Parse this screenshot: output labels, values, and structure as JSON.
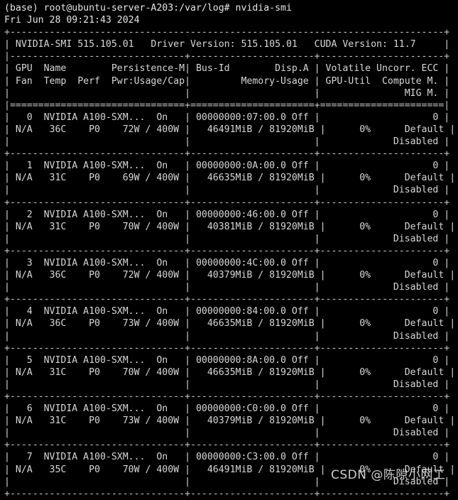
{
  "terminal": {
    "prompt": "(base) root@ubuntu-server-A203:/var/log# nvidia-smi",
    "timestamp": "Fri Jun 28 09:21:43 2024",
    "background_color": "#000000",
    "text_color": "#d8d8d8"
  },
  "smi_header": {
    "smi_label": "NVIDIA-SMI",
    "smi_version": "515.105.01",
    "driver_label": "Driver Version:",
    "driver_version": "515.105.01",
    "cuda_label": "CUDA Version:",
    "cuda_version": "11.7",
    "header_line": "| NVIDIA-SMI 515.105.01   Driver Version: 515.105.01   CUDA Version: 11.7     |"
  },
  "columns": {
    "row1": [
      "GPU",
      "Name",
      "Persistence-M",
      "Bus-Id",
      "Disp.A",
      "Volatile Uncorr. ECC"
    ],
    "row2": [
      "Fan",
      "Temp",
      "Perf",
      "Pwr:Usage/Cap",
      "Memory-Usage",
      "GPU-Util",
      "Compute M."
    ],
    "row3": [
      "MIG M."
    ],
    "header_line_1": "| GPU  Name        Persistence-M| Bus-Id        Disp.A | Volatile Uncorr. ECC |",
    "header_line_2": "| Fan  Temp  Perf  Pwr:Usage/Cap|         Memory-Usage | GPU-Util  Compute M. |",
    "header_line_3": "|                               |                      |               MIG M. |"
  },
  "borders": {
    "top": "+-----------------------------------------------------------------------------+",
    "mid": "|-------------------------------+----------------------+----------------------+",
    "double": "|===============================+======================+======================|",
    "row_sep": "+-------------------------------+----------------------+----------------------+"
  },
  "gpus": [
    {
      "index": "0",
      "name": "NVIDIA A100-SXM...",
      "persistence": "On",
      "bus_id": "00000000:07:00.0",
      "disp_a": "Off",
      "ecc": "0",
      "fan": "N/A",
      "temp": "36C",
      "perf": "P0",
      "power_usage": "72W",
      "power_cap": "400W",
      "mem_used": "46491MiB",
      "mem_total": "81920MiB",
      "gpu_util": "0%",
      "compute_mode": "Default",
      "mig_mode": "Disabled",
      "line1": "|   0  NVIDIA A100-SXM...  On   | 00000000:07:00.0 Off |                    0 |",
      "line2": "| N/A   36C    P0    72W / 400W |   46491MiB / 81920MiB |      0%      Default |",
      "line3": "|                               |                      |             Disabled |"
    },
    {
      "index": "1",
      "name": "NVIDIA A100-SXM...",
      "persistence": "On",
      "bus_id": "00000000:0A:00.0",
      "disp_a": "Off",
      "ecc": "0",
      "fan": "N/A",
      "temp": "31C",
      "perf": "P0",
      "power_usage": "69W",
      "power_cap": "400W",
      "mem_used": "46635MiB",
      "mem_total": "81920MiB",
      "gpu_util": "0%",
      "compute_mode": "Default",
      "mig_mode": "Disabled",
      "line1": "|   1  NVIDIA A100-SXM...  On   | 00000000:0A:00.0 Off |                    0 |",
      "line2": "| N/A   31C    P0    69W / 400W |   46635MiB / 81920MiB |      0%      Default |",
      "line3": "|                               |                      |             Disabled |"
    },
    {
      "index": "2",
      "name": "NVIDIA A100-SXM...",
      "persistence": "On",
      "bus_id": "00000000:46:00.0",
      "disp_a": "Off",
      "ecc": "0",
      "fan": "N/A",
      "temp": "31C",
      "perf": "P0",
      "power_usage": "70W",
      "power_cap": "400W",
      "mem_used": "40381MiB",
      "mem_total": "81920MiB",
      "gpu_util": "0%",
      "compute_mode": "Default",
      "mig_mode": "Disabled",
      "line1": "|   2  NVIDIA A100-SXM...  On   | 00000000:46:00.0 Off |                    0 |",
      "line2": "| N/A   31C    P0    70W / 400W |   40381MiB / 81920MiB |      0%      Default |",
      "line3": "|                               |                      |             Disabled |"
    },
    {
      "index": "3",
      "name": "NVIDIA A100-SXM...",
      "persistence": "On",
      "bus_id": "00000000:4C:00.0",
      "disp_a": "Off",
      "ecc": "0",
      "fan": "N/A",
      "temp": "36C",
      "perf": "P0",
      "power_usage": "72W",
      "power_cap": "400W",
      "mem_used": "40379MiB",
      "mem_total": "81920MiB",
      "gpu_util": "0%",
      "compute_mode": "Default",
      "mig_mode": "Disabled",
      "line1": "|   3  NVIDIA A100-SXM...  On   | 00000000:4C:00.0 Off |                    0 |",
      "line2": "| N/A   36C    P0    72W / 400W |   40379MiB / 81920MiB |      0%      Default |",
      "line3": "|                               |                      |             Disabled |"
    },
    {
      "index": "4",
      "name": "NVIDIA A100-SXM...",
      "persistence": "On",
      "bus_id": "00000000:84:00.0",
      "disp_a": "Off",
      "ecc": "0",
      "fan": "N/A",
      "temp": "36C",
      "perf": "P0",
      "power_usage": "73W",
      "power_cap": "400W",
      "mem_used": "46635MiB",
      "mem_total": "81920MiB",
      "gpu_util": "0%",
      "compute_mode": "Default",
      "mig_mode": "Disabled",
      "line1": "|   4  NVIDIA A100-SXM...  On   | 00000000:84:00.0 Off |                    0 |",
      "line2": "| N/A   36C    P0    73W / 400W |   46635MiB / 81920MiB |      0%      Default |",
      "line3": "|                               |                      |             Disabled |"
    },
    {
      "index": "5",
      "name": "NVIDIA A100-SXM...",
      "persistence": "On",
      "bus_id": "00000000:8A:00.0",
      "disp_a": "Off",
      "ecc": "0",
      "fan": "N/A",
      "temp": "31C",
      "perf": "P0",
      "power_usage": "70W",
      "power_cap": "400W",
      "mem_used": "46635MiB",
      "mem_total": "81920MiB",
      "gpu_util": "0%",
      "compute_mode": "Default",
      "mig_mode": "Disabled",
      "line1": "|   5  NVIDIA A100-SXM...  On   | 00000000:8A:00.0 Off |                    0 |",
      "line2": "| N/A   31C    P0    70W / 400W |   46635MiB / 81920MiB |      0%      Default |",
      "line3": "|                               |                      |             Disabled |"
    },
    {
      "index": "6",
      "name": "NVIDIA A100-SXM...",
      "persistence": "On",
      "bus_id": "00000000:C0:00.0",
      "disp_a": "Off",
      "ecc": "0",
      "fan": "N/A",
      "temp": "31C",
      "perf": "P0",
      "power_usage": "73W",
      "power_cap": "400W",
      "mem_used": "40379MiB",
      "mem_total": "81920MiB",
      "gpu_util": "0%",
      "compute_mode": "Default",
      "mig_mode": "Disabled",
      "line1": "|   6  NVIDIA A100-SXM...  On   | 00000000:C0:00.0 Off |                    0 |",
      "line2": "| N/A   31C    P0    73W / 400W |   40379MiB / 81920MiB |      0%      Default |",
      "line3": "|                               |                      |             Disabled |"
    },
    {
      "index": "7",
      "name": "NVIDIA A100-SXM...",
      "persistence": "On",
      "bus_id": "00000000:C3:00.0",
      "disp_a": "Off",
      "ecc": "0",
      "fan": "N/A",
      "temp": "35C",
      "perf": "P0",
      "power_usage": "70W",
      "power_cap": "400W",
      "mem_used": "46491MiB",
      "mem_total": "81920MiB",
      "gpu_util": "0%",
      "compute_mode": "Default",
      "mig_mode": "Disabled",
      "line1": "|   7  NVIDIA A100-SXM...  On   | 00000000:C3:00.0 Off |                    0 |",
      "line2": "| N/A   35C    P0    70W / 400W |   46491MiB / 81920MiB |      0%      Default |",
      "line3": "|                               |                      |             Disabled |"
    }
  ],
  "watermark": {
    "text": "CSDN @陈隙小网工"
  }
}
